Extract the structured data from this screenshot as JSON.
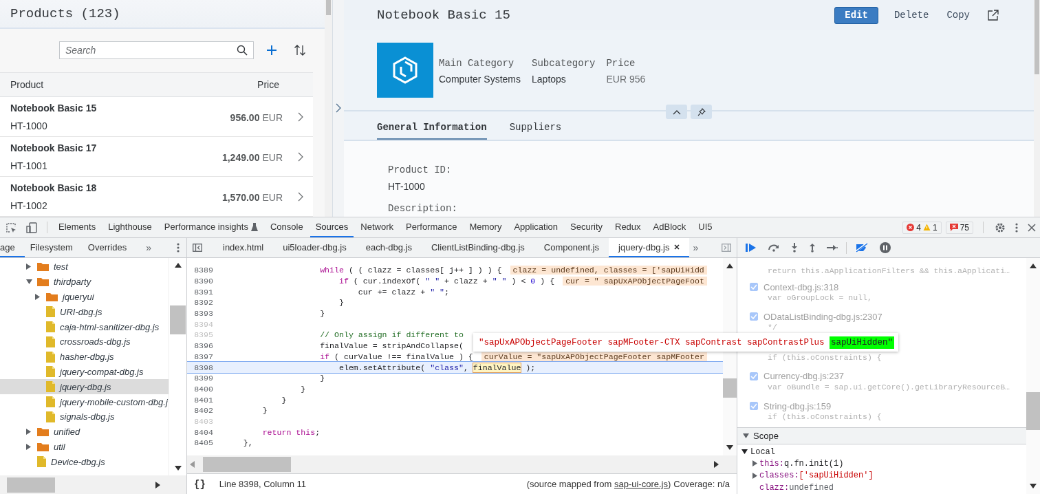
{
  "products": {
    "title": "Products (123)",
    "search": {
      "placeholder": "Search"
    },
    "columns": [
      "Product",
      "Price"
    ],
    "rows": [
      {
        "name": "Notebook Basic 15",
        "id": "HT-1000",
        "amount": "956.00",
        "currency": "EUR"
      },
      {
        "name": "Notebook Basic 17",
        "id": "HT-1001",
        "amount": "1,249.00",
        "currency": "EUR"
      },
      {
        "name": "Notebook Basic 18",
        "id": "HT-1002",
        "amount": "1,570.00",
        "currency": "EUR"
      }
    ]
  },
  "detail": {
    "title": "Notebook Basic 15",
    "actions": [
      {
        "kind": "emphasized",
        "label": "Edit"
      },
      {
        "kind": "text",
        "label": "Delete"
      },
      {
        "kind": "text",
        "label": "Copy"
      },
      {
        "kind": "share"
      }
    ],
    "attributes": [
      {
        "label": "Main Category",
        "value": "Computer Systems",
        "kind": "plain"
      },
      {
        "label": "Subcategory",
        "value": "Laptops",
        "kind": "plain"
      },
      {
        "label": "Price",
        "value": "EUR 956",
        "kind": "muted"
      }
    ],
    "tabs": [
      {
        "label": "General Information",
        "selected": true
      },
      {
        "label": "Suppliers",
        "selected": false
      }
    ],
    "fields": [
      {
        "label": "Product ID:",
        "value": "HT-1000"
      },
      {
        "label": "Description:"
      }
    ]
  },
  "devtools": {
    "panel_tabs": [
      {
        "label": "Elements",
        "selected": false,
        "kind": "plain"
      },
      {
        "label": "Lighthouse",
        "selected": false,
        "kind": "plain"
      },
      {
        "label": "Performance insights",
        "selected": false,
        "kind": "experimental"
      },
      {
        "label": "Console",
        "selected": false,
        "kind": "plain"
      },
      {
        "label": "Sources",
        "selected": true,
        "kind": "plain"
      },
      {
        "label": "Network",
        "selected": false,
        "kind": "plain"
      },
      {
        "label": "Performance",
        "selected": false,
        "kind": "plain"
      },
      {
        "label": "Memory",
        "selected": false,
        "kind": "plain"
      },
      {
        "label": "Application",
        "selected": false,
        "kind": "plain"
      },
      {
        "label": "Security",
        "selected": false,
        "kind": "plain"
      },
      {
        "label": "Redux",
        "selected": false,
        "kind": "plain"
      },
      {
        "label": "AdBlock",
        "selected": false,
        "kind": "plain"
      },
      {
        "label": "UI5",
        "selected": false,
        "kind": "plain"
      }
    ],
    "counts": {
      "errors": "4",
      "warnings": "1",
      "issues": "75"
    },
    "navigator_tabs": [
      {
        "label": "age",
        "selected": true
      },
      {
        "label": "Filesystem",
        "selected": false
      },
      {
        "label": "Overrides",
        "selected": false
      }
    ],
    "more": "»",
    "editor_tabs": [
      {
        "label": "index.html",
        "selected": false
      },
      {
        "label": "ui5loader-dbg.js",
        "selected": false
      },
      {
        "label": "each-dbg.js",
        "selected": false
      },
      {
        "label": "ClientListBinding-dbg.js",
        "selected": false
      },
      {
        "label": "Component.js",
        "selected": false
      },
      {
        "label": "jquery-dbg.js",
        "selected": true
      }
    ],
    "editor_more": "»",
    "file_tree": [
      {
        "kind": "folder",
        "name": "test",
        "expanded": false,
        "selected": false
      },
      {
        "kind": "folder",
        "name": "thirdparty",
        "expanded": true,
        "selected": false,
        "children": [
          {
            "kind": "folder",
            "name": "jqueryui",
            "expanded": false,
            "selected": false
          },
          {
            "kind": "file",
            "name": "URI-dbg.js",
            "selected": false
          },
          {
            "kind": "file",
            "name": "caja-html-sanitizer-dbg.js",
            "selected": false
          },
          {
            "kind": "file",
            "name": "crossroads-dbg.js",
            "selected": false
          },
          {
            "kind": "file",
            "name": "hasher-dbg.js",
            "selected": false
          },
          {
            "kind": "file",
            "name": "jquery-compat-dbg.js",
            "selected": false
          },
          {
            "kind": "file",
            "name": "jquery-dbg.js",
            "selected": true
          },
          {
            "kind": "file",
            "name": "jquery-mobile-custom-dbg.j",
            "selected": false
          },
          {
            "kind": "file",
            "name": "signals-dbg.js",
            "selected": false
          }
        ]
      },
      {
        "kind": "folder",
        "name": "unified",
        "expanded": false,
        "selected": false
      },
      {
        "kind": "folder",
        "name": "util",
        "expanded": false,
        "selected": false
      },
      {
        "kind": "file",
        "name": "Device-dbg.js",
        "selected": false
      }
    ],
    "code_lines": [
      {
        "num": "8389",
        "breakable": true,
        "current": false,
        "segments": [
          {
            "text": "                    while",
            "kind": "keyword"
          },
          {
            "text": " ( ( clazz = classes[ j++ ] ) ) {",
            "kind": "plain"
          }
        ],
        "value": "clazz = undefined, classes = ['sapUiHidd"
      },
      {
        "num": "8390",
        "breakable": true,
        "current": false,
        "segments": [
          {
            "text": "                        if",
            "kind": "keyword"
          },
          {
            "text": " ( cur.indexOf( ",
            "kind": "plain"
          },
          {
            "text": "\" \"",
            "kind": "string"
          },
          {
            "text": " + clazz + ",
            "kind": "plain"
          },
          {
            "text": "\" \"",
            "kind": "string"
          },
          {
            "text": " ) < ",
            "kind": "plain"
          },
          {
            "text": "0",
            "kind": "number"
          },
          {
            "text": " ) {",
            "kind": "plain"
          }
        ],
        "value": "cur = \" sapUxAPObjectPageFoot"
      },
      {
        "num": "8391",
        "breakable": true,
        "current": false,
        "segments": [
          {
            "text": "                            cur += clazz + ",
            "kind": "plain"
          },
          {
            "text": "\" \"",
            "kind": "string"
          },
          {
            "text": ";",
            "kind": "plain"
          }
        ]
      },
      {
        "num": "8392",
        "breakable": true,
        "current": false,
        "segments": [
          {
            "text": "                        }",
            "kind": "plain"
          }
        ]
      },
      {
        "num": "8393",
        "breakable": true,
        "current": false,
        "segments": [
          {
            "text": "                    }",
            "kind": "plain"
          }
        ]
      },
      {
        "num": "8394",
        "breakable": false,
        "current": false
      },
      {
        "num": "8395",
        "breakable": false,
        "current": false,
        "segments": [
          {
            "text": "                    // Only assign if different to",
            "kind": "comment"
          }
        ]
      },
      {
        "num": "8396",
        "breakable": true,
        "current": false,
        "segments": [
          {
            "text": "                    finalValue = stripAndCollapse(",
            "kind": "plain"
          }
        ]
      },
      {
        "num": "8397",
        "breakable": true,
        "current": false,
        "segments": [
          {
            "text": "                    if",
            "kind": "keyword"
          },
          {
            "text": " ( curValue !== finalValue ) {",
            "kind": "plain"
          }
        ],
        "value": "curValue = \"sapUxAPObjectPageFooter sapMFooter"
      },
      {
        "num": "8398",
        "breakable": true,
        "current": true,
        "segments": [
          {
            "text": "                        elem.setAttribute( ",
            "kind": "plain"
          },
          {
            "text": "\"class\"",
            "kind": "string"
          },
          {
            "text": ", ",
            "kind": "plain"
          },
          {
            "text": "finalValue",
            "kind": "hovered"
          },
          {
            "text": " );",
            "kind": "plain"
          }
        ]
      },
      {
        "num": "8399",
        "breakable": true,
        "current": false,
        "segments": [
          {
            "text": "                    }",
            "kind": "plain"
          }
        ]
      },
      {
        "num": "8400",
        "breakable": true,
        "current": false,
        "segments": [
          {
            "text": "                }",
            "kind": "plain"
          }
        ]
      },
      {
        "num": "8401",
        "breakable": true,
        "current": false,
        "segments": [
          {
            "text": "            }",
            "kind": "plain"
          }
        ]
      },
      {
        "num": "8402",
        "breakable": true,
        "current": false,
        "segments": [
          {
            "text": "        }",
            "kind": "plain"
          }
        ]
      },
      {
        "num": "8403",
        "breakable": false,
        "current": false
      },
      {
        "num": "8404",
        "breakable": true,
        "current": false,
        "segments": [
          {
            "text": "        return this",
            "kind": "keyword"
          },
          {
            "text": ";",
            "kind": "plain"
          }
        ]
      },
      {
        "num": "8405",
        "breakable": true,
        "current": false,
        "segments": [
          {
            "text": "    },",
            "kind": "plain"
          }
        ]
      }
    ],
    "tooltip": {
      "text": "\"sapUxAPObjectPageFooter sapMFooter-CTX sapContrast sapContrastPlus ",
      "highlight": "sapUiHidden\""
    },
    "breakpoints": [
      {
        "code": "return this.aApplicationFilters && this.aApplicati…"
      },
      {
        "checked": true,
        "file": "Context-dbg.js:318",
        "code": "var oGroupLock = null,"
      },
      {
        "checked": true,
        "file": "ODataListBinding-dbg.js:2307",
        "code": "*/"
      },
      {
        "code": "if (this.oConstraints) {"
      },
      {
        "checked": true,
        "file": "Currency-dbg.js:237",
        "code": "var oBundle = sap.ui.getCore().getLibraryResourceB…"
      },
      {
        "checked": true,
        "file": "String-dbg.js:159",
        "code": "if (this.oConstraints) {"
      }
    ],
    "scope": {
      "title": "Scope",
      "expanded": true,
      "local": {
        "title": "Local",
        "expanded": true,
        "entries": [
          {
            "name": "this:",
            "value": "q.fn.init(1)",
            "expandable": true,
            "kind": "object"
          },
          {
            "name": "classes:",
            "value": "['sapUiHidden']",
            "expandable": true,
            "kind": "array"
          },
          {
            "name": "clazz:",
            "value": "undefined",
            "expandable": false,
            "kind": "undefined"
          }
        ]
      }
    },
    "status": {
      "pretty_print": "{}",
      "position": "Line 8398, Column 11",
      "source_prefix": "(source mapped from ",
      "source_link": "sap-ui-core.js",
      "source_suffix": ")",
      "coverage": "Coverage: n/a"
    }
  }
}
